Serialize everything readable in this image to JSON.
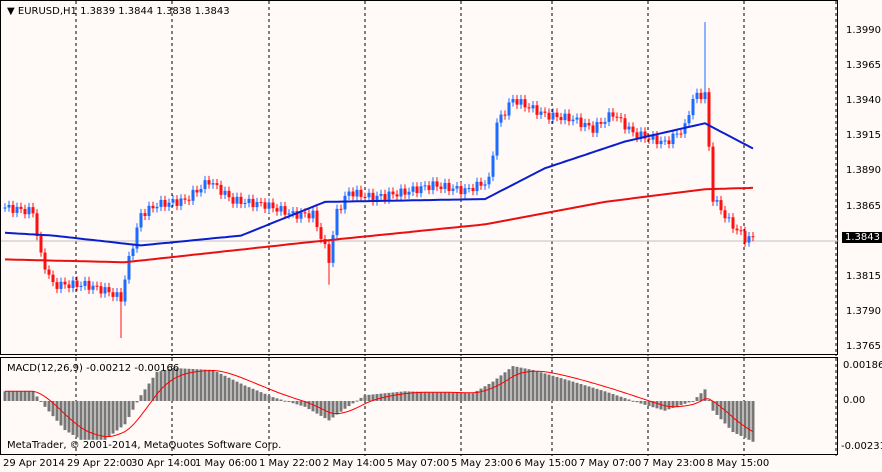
{
  "header": {
    "symbol": "EURUSD,H1",
    "ohlc": "1.3839 1.3844 1.3838 1.3843"
  },
  "macd": {
    "label": "MACD(12,26,9)",
    "values": "-0.00212 -0.00166",
    "scale": [
      "0.00186",
      "0.00",
      "-0.00231"
    ]
  },
  "copyright": "MetaTrader, © 2001-2014, MetaQuotes Software Corp.",
  "current_price": "1.3843",
  "colors": {
    "bull": "#1e6bff",
    "bear": "#ff1010",
    "ma_fast": "#0a1ecc",
    "ma_slow": "#e81010",
    "hist": "#777777",
    "signal": "#ff0000"
  },
  "chart_data": {
    "type": "candlestick",
    "price_axis": [
      "1.3990",
      "1.3965",
      "1.3940",
      "1.3915",
      "1.3890",
      "1.3865",
      "1.3815",
      "1.3790",
      "1.3765"
    ],
    "ylim": [
      1.3757,
      1.4008
    ],
    "time_axis": [
      "29 Apr 2014",
      "29 Apr 22:00",
      "30 Apr 14:00",
      "1 May 06:00",
      "1 May 22:00",
      "2 May 14:00",
      "5 May 07:00",
      "5 May 23:00",
      "6 May 15:00",
      "7 May 07:00",
      "7 May 23:00",
      "8 May 15:00"
    ],
    "close_path": [
      [
        0,
        1.3865
      ],
      [
        7,
        1.3862
      ],
      [
        9,
        1.383
      ],
      [
        12,
        1.381
      ],
      [
        20,
        1.381
      ],
      [
        26,
        1.3805
      ],
      [
        29,
        1.38
      ],
      [
        31,
        1.3828
      ],
      [
        34,
        1.386
      ],
      [
        38,
        1.3867
      ],
      [
        45,
        1.387
      ],
      [
        51,
        1.3884
      ],
      [
        57,
        1.387
      ],
      [
        65,
        1.3867
      ],
      [
        72,
        1.386
      ],
      [
        77,
        1.386
      ],
      [
        81,
        1.3828
      ],
      [
        83,
        1.3862
      ],
      [
        86,
        1.3876
      ],
      [
        92,
        1.3872
      ],
      [
        100,
        1.3876
      ],
      [
        107,
        1.3881
      ],
      [
        115,
        1.3877
      ],
      [
        121,
        1.3884
      ],
      [
        123,
        1.3925
      ],
      [
        127,
        1.3942
      ],
      [
        135,
        1.3931
      ],
      [
        142,
        1.3928
      ],
      [
        147,
        1.3921
      ],
      [
        152,
        1.3932
      ],
      [
        157,
        1.3918
      ],
      [
        165,
        1.3911
      ],
      [
        170,
        1.3922
      ],
      [
        172,
        1.3943
      ],
      [
        175,
        1.3946
      ],
      [
        176,
        1.3907
      ],
      [
        177,
        1.3872
      ],
      [
        181,
        1.3855
      ],
      [
        185,
        1.3843
      ]
    ],
    "spikes": [
      [
        29,
        1.3772
      ],
      [
        81,
        1.381
      ],
      [
        175,
        1.3997
      ]
    ],
    "ma_fast": [
      [
        0,
        1.3847
      ],
      [
        12,
        1.3845
      ],
      [
        34,
        1.3838
      ],
      [
        59,
        1.3845
      ],
      [
        80,
        1.3869
      ],
      [
        120,
        1.3871
      ],
      [
        135,
        1.3893
      ],
      [
        155,
        1.3912
      ],
      [
        175,
        1.3925
      ],
      [
        187,
        1.3907
      ]
    ],
    "ma_slow": [
      [
        0,
        1.3828
      ],
      [
        30,
        1.3826
      ],
      [
        75,
        1.384
      ],
      [
        120,
        1.3853
      ],
      [
        150,
        1.3869
      ],
      [
        175,
        1.3878
      ],
      [
        187,
        1.3879
      ]
    ],
    "macd_hist": [
      [
        0,
        0.0005
      ],
      [
        7,
        0.0005
      ],
      [
        10,
        -0.0003
      ],
      [
        15,
        -0.0015
      ],
      [
        19,
        -0.002
      ],
      [
        25,
        -0.002
      ],
      [
        30,
        -0.0012
      ],
      [
        34,
        0.0003
      ],
      [
        38,
        0.0015
      ],
      [
        42,
        0.0017
      ],
      [
        52,
        0.0016
      ],
      [
        60,
        0.0008
      ],
      [
        67,
        0.0002
      ],
      [
        75,
        -0.0003
      ],
      [
        81,
        -0.001
      ],
      [
        85,
        -0.0004
      ],
      [
        90,
        0.0003
      ],
      [
        100,
        0.0005
      ],
      [
        117,
        0.0004
      ],
      [
        122,
        0.001
      ],
      [
        127,
        0.0018
      ],
      [
        132,
        0.0016
      ],
      [
        142,
        0.001
      ],
      [
        150,
        0.0005
      ],
      [
        160,
        -0.0002
      ],
      [
        165,
        -0.0005
      ],
      [
        172,
        0.0
      ],
      [
        175,
        0.0006
      ],
      [
        177,
        -0.0005
      ],
      [
        182,
        -0.0016
      ],
      [
        187,
        -0.0021
      ]
    ],
    "macd_ylim": [
      -0.00231,
      0.00186
    ]
  }
}
